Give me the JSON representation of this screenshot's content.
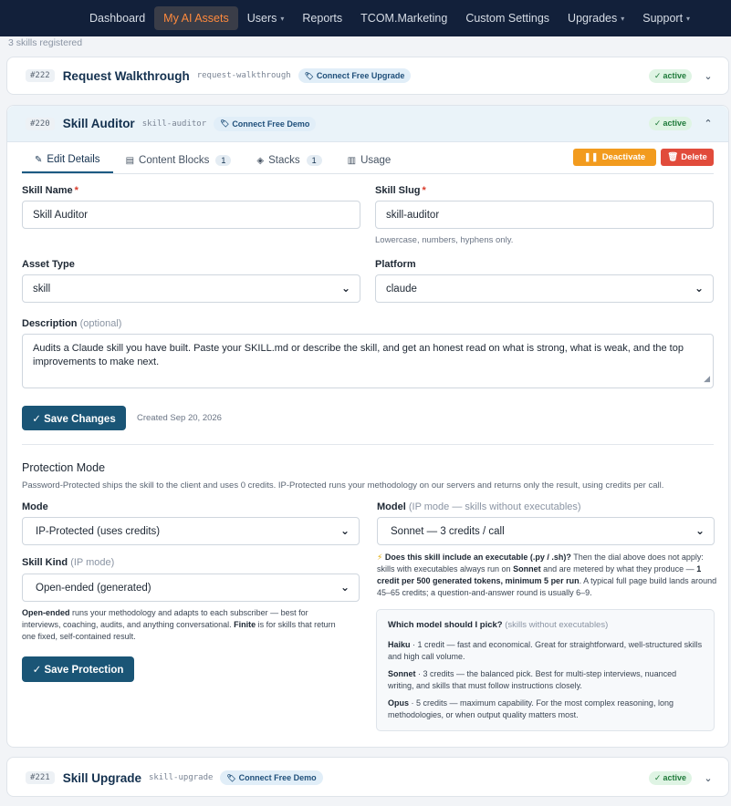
{
  "nav": {
    "items": [
      {
        "label": "Dashboard",
        "caret": false
      },
      {
        "label": "My AI Assets",
        "caret": false,
        "active": true
      },
      {
        "label": "Users",
        "caret": true
      },
      {
        "label": "Reports",
        "caret": false
      },
      {
        "label": "TCOM.Marketing",
        "caret": false
      },
      {
        "label": "Custom Settings",
        "caret": false
      },
      {
        "label": "Upgrades",
        "caret": true
      },
      {
        "label": "Support",
        "caret": true
      }
    ],
    "caret_glyph": "▾"
  },
  "registered": "3 skills registered",
  "skills": [
    {
      "id": "#222",
      "name": "Request Walkthrough",
      "slug": "request-walkthrough",
      "tag": "Connect Free Upgrade",
      "status": "active"
    },
    {
      "id": "#220",
      "name": "Skill Auditor",
      "slug": "skill-auditor",
      "tag": "Connect Free Demo",
      "status": "active"
    },
    {
      "id": "#221",
      "name": "Skill Upgrade",
      "slug": "skill-upgrade",
      "tag": "Connect Free Demo",
      "status": "active"
    }
  ],
  "tabs": [
    {
      "label": "Edit Details",
      "icon": "✎"
    },
    {
      "label": "Content Blocks",
      "icon": "▤",
      "count": "1"
    },
    {
      "label": "Stacks",
      "icon": "◈",
      "count": "1"
    },
    {
      "label": "Usage",
      "icon": "▥"
    }
  ],
  "actions": {
    "deactivate": "Deactivate",
    "delete": "Delete"
  },
  "form": {
    "skill_name_label": "Skill Name",
    "skill_name_value": "Skill Auditor",
    "skill_slug_label": "Skill Slug",
    "skill_slug_value": "skill-auditor",
    "slug_help": "Lowercase, numbers, hyphens only.",
    "asset_type_label": "Asset Type",
    "asset_type_value": "skill",
    "platform_label": "Platform",
    "platform_value": "claude",
    "description_label": "Description",
    "description_optional": "(optional)",
    "description_value": "Audits a Claude skill you have built. Paste your SKILL.md or describe the skill, and get an honest read on what is strong, what is weak, and the top improvements to make next.",
    "save_changes": "✓ Save Changes",
    "created": "Created Sep 20, 2026",
    "required": "*"
  },
  "protection": {
    "title": "Protection Mode",
    "description": "Password-Protected ships the skill to the client and uses 0 credits. IP-Protected runs your methodology on our servers and returns only the result, using credits per call.",
    "mode_label": "Mode",
    "mode_value": "IP-Protected (uses credits)",
    "model_label": "Model",
    "model_hint": "(IP mode — skills without executables)",
    "model_value": "Sonnet — 3 credits / call",
    "kind_label": "Skill Kind",
    "kind_hint": "(IP mode)",
    "kind_value": "Open-ended (generated)",
    "exec_q": "Does this skill include an executable (.py / .sh)?",
    "exec_1": " Then the dial above does not apply: skills with executables always run on ",
    "exec_sonnet": "Sonnet",
    "exec_2": " and are metered by what they produce — ",
    "exec_rate": "1 credit per 500 generated tokens, minimum 5 per run",
    "exec_3": ". A typical full page build lands around 45–65 credits; a question-and-answer round is usually 6–9.",
    "kind_open": "Open-ended",
    "kind_help_1": " runs your methodology and adapts to each subscriber — best for interviews, coaching, audits, and anything conversational. ",
    "kind_finite": "Finite",
    "kind_help_2": " is for skills that return one fixed, self-contained result.",
    "save": "✓ Save Protection",
    "panel_title": "Which model should I pick?",
    "panel_hint": "(skills without executables)",
    "haiku_name": "Haiku",
    "haiku_text": " · 1 credit — fast and economical. Great for straightforward, well-structured skills and high call volume.",
    "sonnet_name": "Sonnet",
    "sonnet_text": " · 3 credits — the balanced pick. Best for multi-step interviews, nuanced writing, and skills that must follow instructions closely.",
    "opus_name": "Opus",
    "opus_text": " · 5 credits — maximum capability. For the most complex reasoning, long methodologies, or when output quality matters most."
  }
}
